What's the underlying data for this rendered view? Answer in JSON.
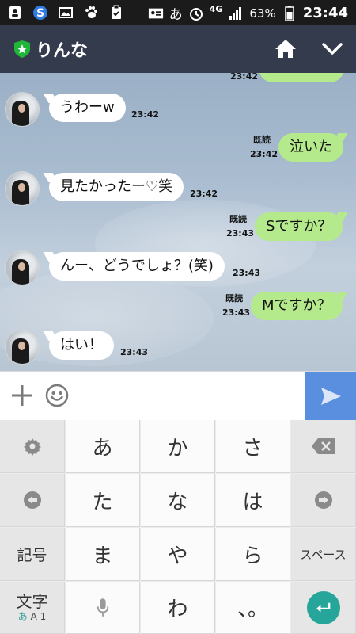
{
  "status_bar": {
    "icons_left": [
      "contacts-icon",
      "app-s-icon",
      "image-icon",
      "paw-icon",
      "clipboard-icon"
    ],
    "keyboard_indicator": "あ",
    "network": "4G",
    "battery": "63%",
    "time": "23:44"
  },
  "header": {
    "title": "りんな",
    "icons": [
      "shield-star-icon",
      "home-icon",
      "chevron-down-icon"
    ]
  },
  "messages": [
    {
      "side": "out",
      "text": "",
      "time": "23:42",
      "read": ""
    },
    {
      "side": "in",
      "text": "うわーw",
      "time": "23:42"
    },
    {
      "side": "out",
      "text": "泣いた",
      "time": "23:42",
      "read": "既読"
    },
    {
      "side": "in",
      "text": "見たかったー♡笑",
      "time": "23:42"
    },
    {
      "side": "out",
      "text": "Sですか？",
      "time": "23:43",
      "read": "既読"
    },
    {
      "side": "in",
      "text": "んー、どうでしょ？(笑)",
      "time": "23:43"
    },
    {
      "side": "out",
      "text": "Mですか？",
      "time": "23:43",
      "read": "既読"
    },
    {
      "side": "in",
      "text": "はい！",
      "time": "23:43"
    }
  ],
  "input": {
    "placeholder": "",
    "icons": [
      "plus-icon",
      "smile-icon",
      "send-icon"
    ]
  },
  "keyboard": {
    "row1": [
      "あ",
      "か",
      "さ"
    ],
    "row2": [
      "た",
      "な",
      "は"
    ],
    "row3": [
      "ま",
      "や",
      "ら"
    ],
    "row4": [
      "",
      "わ",
      "、。"
    ],
    "kigou": "記号",
    "space": "スペース",
    "moji_top": "文字",
    "moji_a": "あ",
    "moji_rest": "A 1"
  },
  "colors": {
    "header_bg": "#343b4c",
    "bubble_out": "#b4ea8c",
    "bubble_in": "#ffffff",
    "send_bg": "#5a8fe0",
    "enter_bg": "#26a69a"
  }
}
